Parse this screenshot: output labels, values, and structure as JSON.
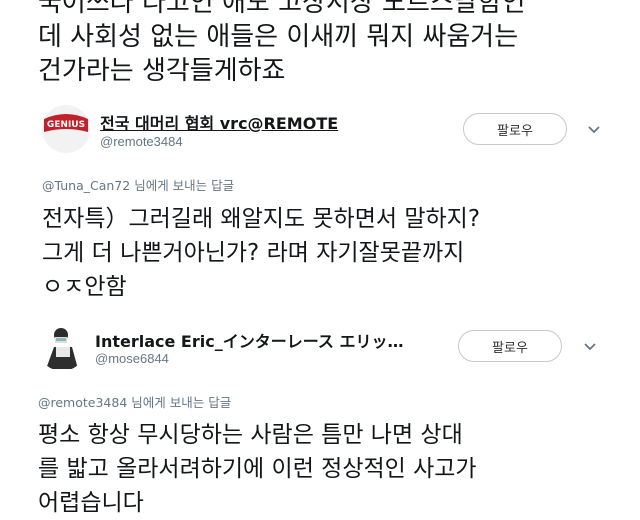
{
  "top_text": {
    "lines": [
      "국어쓰라 라고인 애도 고상서상 노르스달함인",
      "데 사회성 없는 애들은 이새끼 뭐지 싸움거는",
      "건가라는 생각들게하죠"
    ]
  },
  "reply1": {
    "display_name": "전국 대머리 협회 vrc@REMOTE",
    "handle": "@remote3484",
    "follow_label": "팔로우",
    "replying_to_handle": "@Tuna_Can72",
    "replying_to_suffix": " 님에게 보내는 답글",
    "body_lines": [
      "전자특）그러길래 왜알지도 못하면서 말하지?",
      " 그게 더 나쁜거아닌가? 라며 자기잘못끝까지",
      "ㅇㅈ안함"
    ],
    "avatar_text": "GENIUS"
  },
  "reply2": {
    "display_name": "Interlace Eric_インターレース エリッ…",
    "handle": "@mose6844",
    "follow_label": "팔로우",
    "replying_to_handle": "@remote3484",
    "replying_to_suffix": " 님에게 보내는 답글",
    "body_lines": [
      "평소 항상 무시당하는 사람은 틈만 나면 상대",
      "를 밟고 올라서려하기에 이런 정상적인 사고가",
      "어렵습니다"
    ]
  },
  "colors": {
    "text": "#14171a",
    "secondary": "#657786",
    "button_border": "#c8c8c8",
    "avatar_red": "#c0212b"
  },
  "icons": {
    "more_menu": "chevron-down-icon"
  }
}
